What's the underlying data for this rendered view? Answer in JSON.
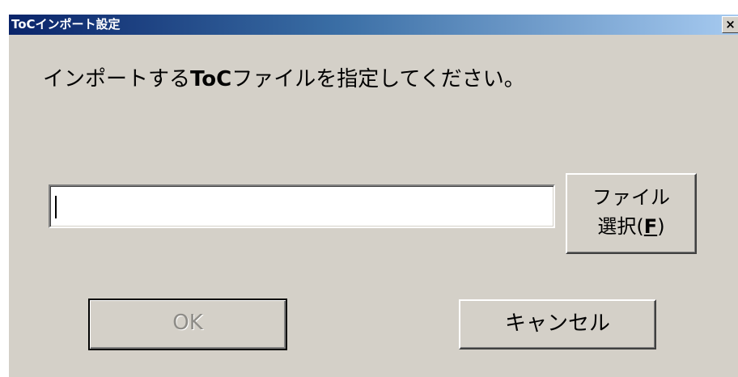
{
  "window": {
    "title": "ToCインポート設定",
    "close_glyph": "×"
  },
  "dialog": {
    "prompt_before": "インポートする",
    "prompt_bold": "ToC",
    "prompt_after": "ファイルを指定してください。",
    "path_input": {
      "value": "",
      "placeholder": ""
    }
  },
  "buttons": {
    "file_select_line1": "ファイル",
    "file_select_line2": "選択(",
    "file_select_accel": "F",
    "file_select_close": ")",
    "ok_label": "OK",
    "ok_enabled": false,
    "cancel_label": "キャンセル"
  },
  "colors": {
    "title_gradient_start": "#0a246a",
    "title_gradient_end": "#a6caf0",
    "face": "#d4d0c8",
    "disabled_text": "#8e8c87"
  }
}
